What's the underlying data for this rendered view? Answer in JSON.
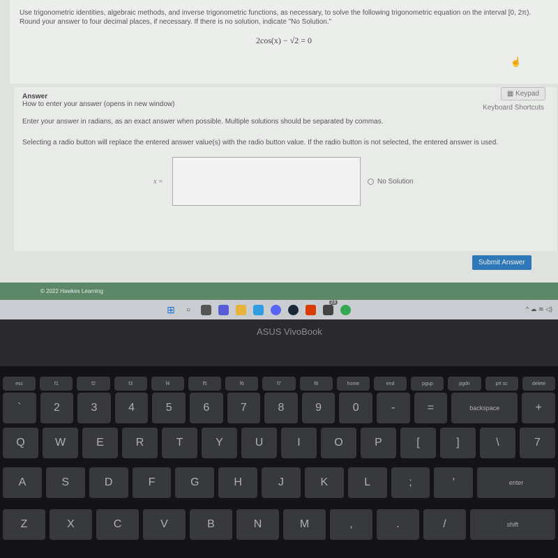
{
  "question": {
    "line1": "Use trigonometric identities, algebraic methods, and inverse trigonometric functions, as necessary, to solve the following trigonometric equation on the interval [0, 2π).",
    "line2": "Round your answer to four decimal places, if necessary. If there is no solution, indicate \"No Solution.\"",
    "equation": "2cos(x) − √2 = 0"
  },
  "answer": {
    "heading": "Answer",
    "how_to": "How to enter your answer (opens in new window)",
    "keypad": "Keypad",
    "shortcuts": "Keyboard Shortcuts",
    "instr1": "Enter your answer in radians, as an exact answer when possible. Multiple solutions should be separated by commas.",
    "instr2": "Selecting a radio button will replace the entered answer value(s) with the radio button value. If the radio button is not selected, the entered answer is used.",
    "x_label": "x =",
    "input_value": "",
    "no_solution": "No Solution",
    "submit": "Submit Answer"
  },
  "footer": {
    "copyright": "© 2022 Hawkes Learning"
  },
  "taskbar": {
    "badge": "23"
  },
  "laptop": {
    "brand": "ASUS VivoBook"
  },
  "keyboard": {
    "fn": [
      "esc",
      "f1",
      "f2",
      "f3",
      "f4",
      "f5",
      "f6",
      "f7",
      "f8",
      "home",
      "end",
      "pgup",
      "pgdn",
      "prt sc",
      "delete"
    ],
    "num": [
      "`",
      "2",
      "3",
      "4",
      "5",
      "6",
      "7",
      "8",
      "9",
      "0",
      "-",
      "=",
      "backspace",
      "+"
    ],
    "q": [
      "Q",
      "W",
      "E",
      "R",
      "T",
      "Y",
      "U",
      "I",
      "O",
      "P",
      "[",
      "]",
      "\\",
      "7"
    ],
    "a": [
      "A",
      "S",
      "D",
      "F",
      "G",
      "H",
      "J",
      "K",
      "L",
      ";",
      "'",
      "enter"
    ],
    "z": [
      "Z",
      "X",
      "C",
      "V",
      "B",
      "N",
      "M",
      ",",
      ".",
      "/",
      "shift"
    ]
  }
}
